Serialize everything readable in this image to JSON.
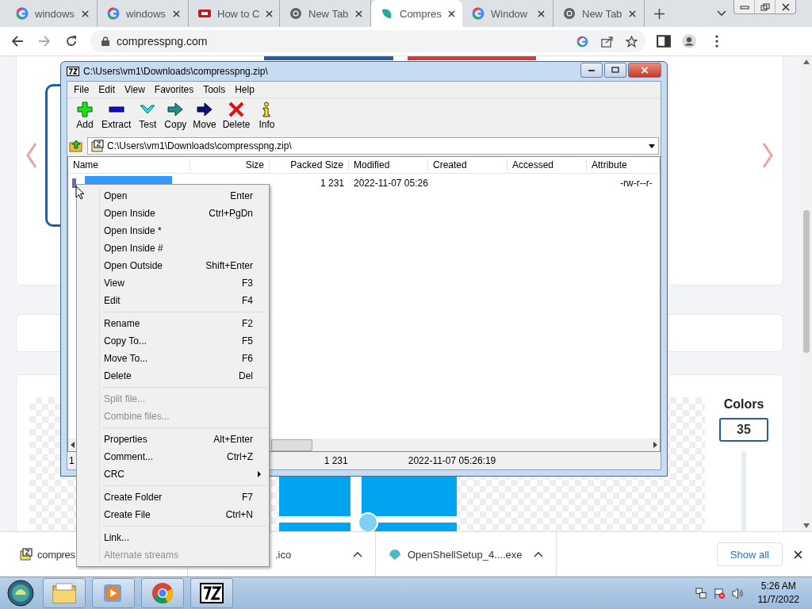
{
  "browser": {
    "tabs": [
      {
        "title": "windows",
        "kind": "google",
        "selected": false
      },
      {
        "title": "windows",
        "kind": "google",
        "selected": false
      },
      {
        "title": "How to C",
        "kind": "video",
        "selected": false
      },
      {
        "title": "New Tab",
        "kind": "chrome",
        "selected": false
      },
      {
        "title": "Compres",
        "kind": "leaf",
        "selected": true
      },
      {
        "title": "Window",
        "kind": "google",
        "selected": false
      },
      {
        "title": "New Tab",
        "kind": "chrome",
        "selected": false
      }
    ],
    "address": "compresspng.com"
  },
  "page": {
    "colors_label": "Colors",
    "colors_value": "35"
  },
  "archive_window": {
    "title": "C:\\Users\\vm1\\Downloads\\compresspng.zip\\",
    "menu": [
      "File",
      "Edit",
      "View",
      "Favorites",
      "Tools",
      "Help"
    ],
    "toolbar": [
      {
        "label": "Add",
        "kind": "add"
      },
      {
        "label": "Extract",
        "kind": "extract"
      },
      {
        "label": "Test",
        "kind": "test"
      },
      {
        "label": "Copy",
        "kind": "copy"
      },
      {
        "label": "Move",
        "kind": "move"
      },
      {
        "label": "Delete",
        "kind": "delete"
      },
      {
        "label": "Info",
        "kind": "info"
      }
    ],
    "path": "C:\\Users\\vm1\\Downloads\\compresspng.zip\\",
    "columns": [
      "Name",
      "Size",
      "Packed Size",
      "Modified",
      "Created",
      "Accessed",
      "Attribute"
    ],
    "rows": [
      {
        "selected": true,
        "packed_size": "1 231",
        "modified": "2022-11-07 05:26",
        "attributes": "-rw-r--r-"
      }
    ],
    "status": {
      "count": "1",
      "packed": "1 231",
      "modified": "2022-11-07 05:26:19"
    }
  },
  "context_menu": [
    {
      "kind": "item",
      "label": "Open",
      "shortcut": "Enter",
      "disabled": false
    },
    {
      "kind": "item",
      "label": "Open Inside",
      "shortcut": "Ctrl+PgDn",
      "disabled": false
    },
    {
      "kind": "item",
      "label": "Open Inside *",
      "disabled": false
    },
    {
      "kind": "item",
      "label": "Open Inside #",
      "disabled": false
    },
    {
      "kind": "item",
      "label": "Open Outside",
      "shortcut": "Shift+Enter",
      "disabled": false
    },
    {
      "kind": "item",
      "label": "View",
      "shortcut": "F3",
      "disabled": false
    },
    {
      "kind": "item",
      "label": "Edit",
      "shortcut": "F4",
      "disabled": false
    },
    {
      "kind": "separator"
    },
    {
      "kind": "item",
      "label": "Rename",
      "shortcut": "F2",
      "disabled": false
    },
    {
      "kind": "item",
      "label": "Copy To...",
      "shortcut": "F5",
      "disabled": false
    },
    {
      "kind": "item",
      "label": "Move To...",
      "shortcut": "F6",
      "disabled": false
    },
    {
      "kind": "item",
      "label": "Delete",
      "shortcut": "Del",
      "disabled": false
    },
    {
      "kind": "separator"
    },
    {
      "kind": "item",
      "label": "Split file...",
      "disabled": true
    },
    {
      "kind": "item",
      "label": "Combine files...",
      "disabled": true
    },
    {
      "kind": "separator"
    },
    {
      "kind": "item",
      "label": "Properties",
      "shortcut": "Alt+Enter",
      "disabled": false
    },
    {
      "kind": "item",
      "label": "Comment...",
      "shortcut": "Ctrl+Z",
      "disabled": false
    },
    {
      "kind": "item",
      "label": "CRC",
      "submenu": true,
      "disabled": false
    },
    {
      "kind": "separator"
    },
    {
      "kind": "item",
      "label": "Create Folder",
      "shortcut": "F7",
      "disabled": false
    },
    {
      "kind": "item",
      "label": "Create File",
      "shortcut": "Ctrl+N",
      "disabled": false
    },
    {
      "kind": "separator"
    },
    {
      "kind": "item",
      "label": "Link...",
      "disabled": false
    },
    {
      "kind": "item",
      "label": "Alternate streams",
      "disabled": true
    }
  ],
  "downloads": {
    "items": [
      {
        "name": "compres",
        "kind": "archive"
      },
      {
        "name": ".ico",
        "kind": "none",
        "menu_button": true
      },
      {
        "name": "OpenShellSetup_4....exe",
        "kind": "shell",
        "menu_button": true
      }
    ],
    "show_all": "Show all"
  },
  "taskbar": {
    "apps": [
      {
        "kind": "folder"
      },
      {
        "kind": "media"
      },
      {
        "kind": "chrome"
      },
      {
        "kind": "sevenzip"
      }
    ],
    "time": "5:26 AM",
    "date": "11/7/2022"
  }
}
